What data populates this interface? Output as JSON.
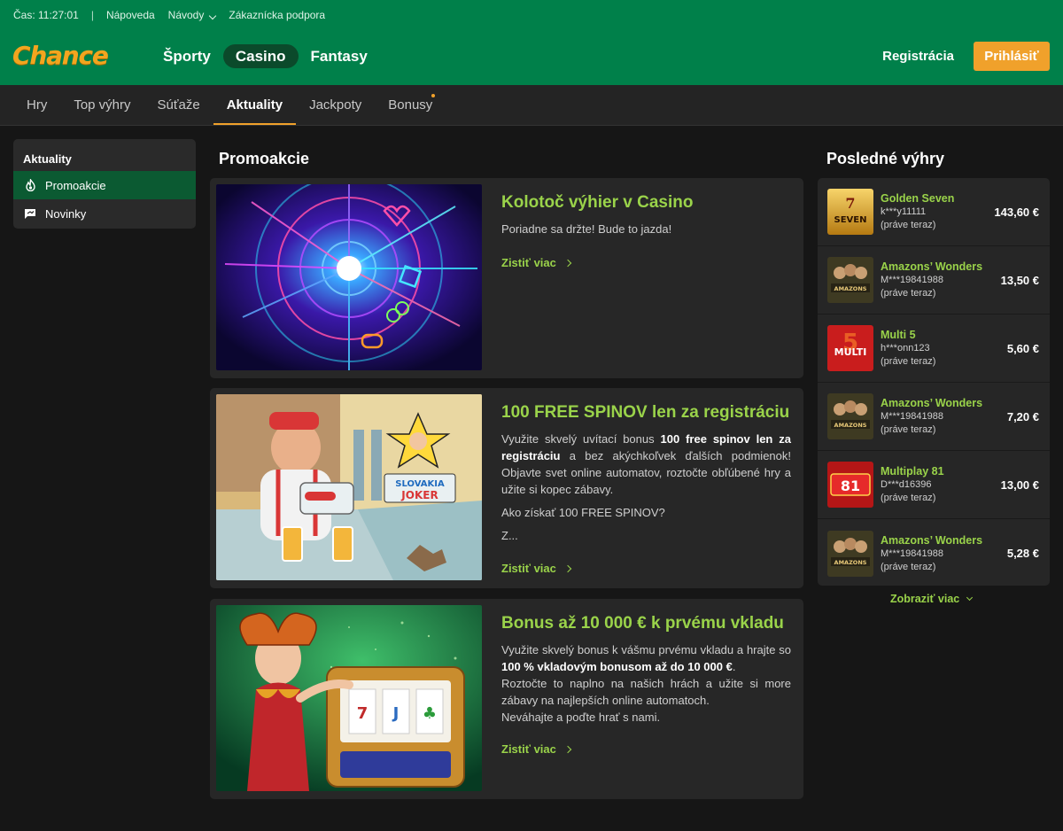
{
  "utility": {
    "time": "Čas: 11:27:01",
    "help": "Nápoveda",
    "guides": "Návody",
    "support": "Zákaznícka podpora"
  },
  "brand": {
    "logo": "Chance"
  },
  "main_nav": {
    "sports": "Športy",
    "casino": "Casino",
    "fantasy": "Fantasy"
  },
  "auth": {
    "register": "Registrácia",
    "login": "Prihlásiť"
  },
  "sub_nav": [
    "Hry",
    "Top výhry",
    "Súťaže",
    "Aktuality",
    "Jackpoty",
    "Bonusy"
  ],
  "sidebar": {
    "heading": "Aktuality",
    "items": [
      "Promoakcie",
      "Novinky"
    ]
  },
  "promos_title": "Promoakcie",
  "promos": [
    {
      "title": "Kolotoč výhier v Casino",
      "text": "Poriadne sa držte! Bude to jazda!",
      "more": "Zistiť viac"
    },
    {
      "title": "100 FREE SPINOV len za registráciu",
      "t1": "Využite skvelý uvítací bonus ",
      "b1": "100 free spinov len za registráciu",
      "t2": " a bez akýchkoľvek ďalších podmienok! Objavte svet online automatov, roztočte obľúbené hry a užite si kopec zábavy.",
      "p2": "Ako získať 100 FREE SPINOV?",
      "p3": "Z...",
      "more": "Zistiť viac",
      "art_badge": "SLOVAKIA JOKER"
    },
    {
      "title": "Bonus až 10 000 € k prvému vkladu",
      "t1": "Využite skvelý bonus k vášmu prvému vkladu a hrajte so ",
      "b1": "100 % vkladovým bonusom až do 10 000 €",
      "t2": ".",
      "l2": "Roztočte to naplno na našich hrách a užite si more zábavy na najlepších online automatoch.",
      "l3": "Neváhajte a poďte hrať s nami.",
      "more": "Zistiť viac"
    }
  ],
  "wins_title": "Posledné výhry",
  "wins": [
    {
      "game": "Golden Seven",
      "user": "k***y11111",
      "when": "(práve teraz)",
      "amount": "143,60 €",
      "thumb_text": "SEVEN"
    },
    {
      "game": "Amazons’ Wonders",
      "user": "M***19841988",
      "when": "(práve teraz)",
      "amount": "13,50 €",
      "thumb_text": "AMAZONS"
    },
    {
      "game": "Multi 5",
      "user": "h***onn123",
      "when": "(práve teraz)",
      "amount": "5,60 €",
      "thumb_text": "MULTI"
    },
    {
      "game": "Amazons’ Wonders",
      "user": "M***19841988",
      "when": "(práve teraz)",
      "amount": "7,20 €",
      "thumb_text": "AMAZONS"
    },
    {
      "game": "Multiplay 81",
      "user": "D***d16396",
      "when": "(práve teraz)",
      "amount": "13,00 €",
      "thumb_text": "81"
    },
    {
      "game": "Amazons’ Wonders",
      "user": "M***19841988",
      "when": "(práve teraz)",
      "amount": "5,28 €",
      "thumb_text": "AMAZONS"
    }
  ],
  "show_more": "Zobraziť viac",
  "colors": {
    "header_green": "#00804a",
    "accent_orange": "#f0a12b",
    "link_green": "#9ad34a",
    "active_sidebar": "#0b5a32"
  }
}
